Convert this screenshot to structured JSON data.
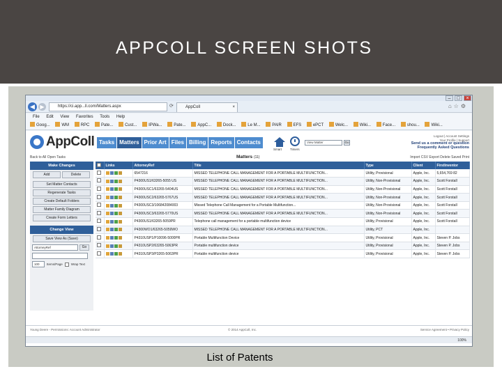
{
  "slide": {
    "title": "APPCOLL SCREEN SHOTS",
    "caption": "List of Patents"
  },
  "browser": {
    "url": "https://ci.app...ll.com/Matters.aspx",
    "tab_title": "AppColl",
    "menu": [
      "File",
      "Edit",
      "View",
      "Favorites",
      "Tools",
      "Help"
    ],
    "favorites": [
      "Goog...",
      "WM",
      "RPC",
      "Pate...",
      "Cust...",
      "IPWa...",
      "Pate...",
      "AppC...",
      "Dock...",
      "Le M...",
      "PAIR",
      "EFS",
      "ePCT",
      "Welc...",
      "Wiki...",
      "Face...",
      "shou...",
      "Wiki..."
    ],
    "zoom": "100%"
  },
  "app": {
    "logo": "AppColl",
    "nav": [
      "Tasks",
      "Matters",
      "Prior Art",
      "Files",
      "Billing",
      "Reports",
      "Contacts"
    ],
    "active_nav": "Matters",
    "home_label": "Smart",
    "timers_label": "Timers",
    "search_placeholder": "View Matter",
    "go_label": "Go",
    "top_right": {
      "line1": "Logout | Account Settings",
      "line2": "Your Profile | Support",
      "line3": "Send us a comment or question",
      "line4": "Frequently Asked Questions"
    },
    "back_link": "Back to All Open Tasks",
    "page_title": "Matters",
    "page_count": "(11)",
    "sub_right": "Import CSV  Export  Delete Saved  Print",
    "left_panel": {
      "make_changes": "Make Changes",
      "add": "Add",
      "delete": "Delete",
      "set_matter_contacts": "Set Matter Contacts",
      "regenerate_tasks": "Regenerate Tasks",
      "create_default_folders": "Create Default Folders",
      "matter_family_diagram": "Matter Family Diagram",
      "create_form_letters": "Create Form Letters",
      "change_view": "Change View",
      "save_view_as": "Save View As (Save)",
      "view_select": "AttorneyRef",
      "go": "Go",
      "items_per_page": "100",
      "items_label": "Items/Page",
      "wrap_text": "Wrap Text"
    },
    "table": {
      "columns": [
        "",
        "Links",
        "AttorneyRef",
        "Title",
        "Type",
        "Client",
        "FirstInventor"
      ],
      "rows": [
        {
          "ref": "6547216",
          "title": "MISSED TELEPHONE CALL MANAGEMENT FOR A PORTABLE MULTIFUNCTION...",
          "type": "Utility, Provisional",
          "client": "Apple, Inc.",
          "inventor": "5,654,769 82"
        },
        {
          "ref": "P4300US1/63265-5055 US",
          "title": "MISSED TELEPHONE CALL MANAGEMENT FOR A PORTABLE MULTIFUNCTION...",
          "type": "Utility, Non-Provisional",
          "client": "Apple, Inc.",
          "inventor": "Scott Forstall"
        },
        {
          "ref": "P4300USC1/63265-5404US",
          "title": "MISSED TELEPHONE CALL MANAGEMENT FOR A PORTABLE MULTIFUNCTION...",
          "type": "Utility, Non-Provisional",
          "client": "Apple, Inc.",
          "inventor": "Scott Forstall"
        },
        {
          "ref": "P4300USC2/63265-5767US",
          "title": "MISSED TELEPHONE CALL MANAGEMENT FOR A PORTABLE MULTIFUNCTION...",
          "type": "Utility, Non-Provisional",
          "client": "Apple, Inc.",
          "inventor": "Scott Forstall"
        },
        {
          "ref": "P4300USC3/106842084003",
          "title": "Missed Telephone Call Management for a Portable Multifunction...",
          "type": "Utility, Non-Provisional",
          "client": "Apple, Inc.",
          "inventor": "Scott Forstall"
        },
        {
          "ref": "P4300USC3/63265-5770US",
          "title": "MISSED TELEPHONE CALL MANAGEMENT FOR A PORTABLE MULTIFUNCTION...",
          "type": "Utility, Non-Provisional",
          "client": "Apple, Inc.",
          "inventor": "Scott Forstall"
        },
        {
          "ref": "P4300US1/63265-5059PR",
          "title": "Telephone call management for a portable multifunction device",
          "type": "Utility, Provisional",
          "client": "Apple, Inc.",
          "inventor": "Scott Forstall"
        },
        {
          "ref": "P4300WO1/63265-5059WO",
          "title": "MISSED TELEPHONE CALL MANAGEMENT FOR A PORTABLE MULTIFUNCTION...",
          "type": "Utility, PCT",
          "client": "Apple, Inc.",
          "inventor": ""
        },
        {
          "ref": "P4310USP1/P10096-5000PR",
          "title": "Portable Multifunction Device",
          "type": "Utility, Provisional",
          "client": "Apple, Inc.",
          "inventor": "Steven P. Jobs"
        },
        {
          "ref": "P4310USP2/63265-5063PR",
          "title": "Portable multifunction device",
          "type": "Utility, Provisional",
          "client": "Apple, Inc.",
          "inventor": "Steven P. Jobs"
        },
        {
          "ref": "P4310USP3/P3265-5063PR",
          "title": "Portable multifunction device",
          "type": "Utility, Provisional",
          "client": "Apple, Inc.",
          "inventor": "Steven P. Jobs"
        }
      ]
    },
    "footer": {
      "left": "Young Deere - Permissions: Account Administrator",
      "center": "© 2014 AppColl, Inc.",
      "right": "Service Agreement • Privacy Policy"
    }
  }
}
